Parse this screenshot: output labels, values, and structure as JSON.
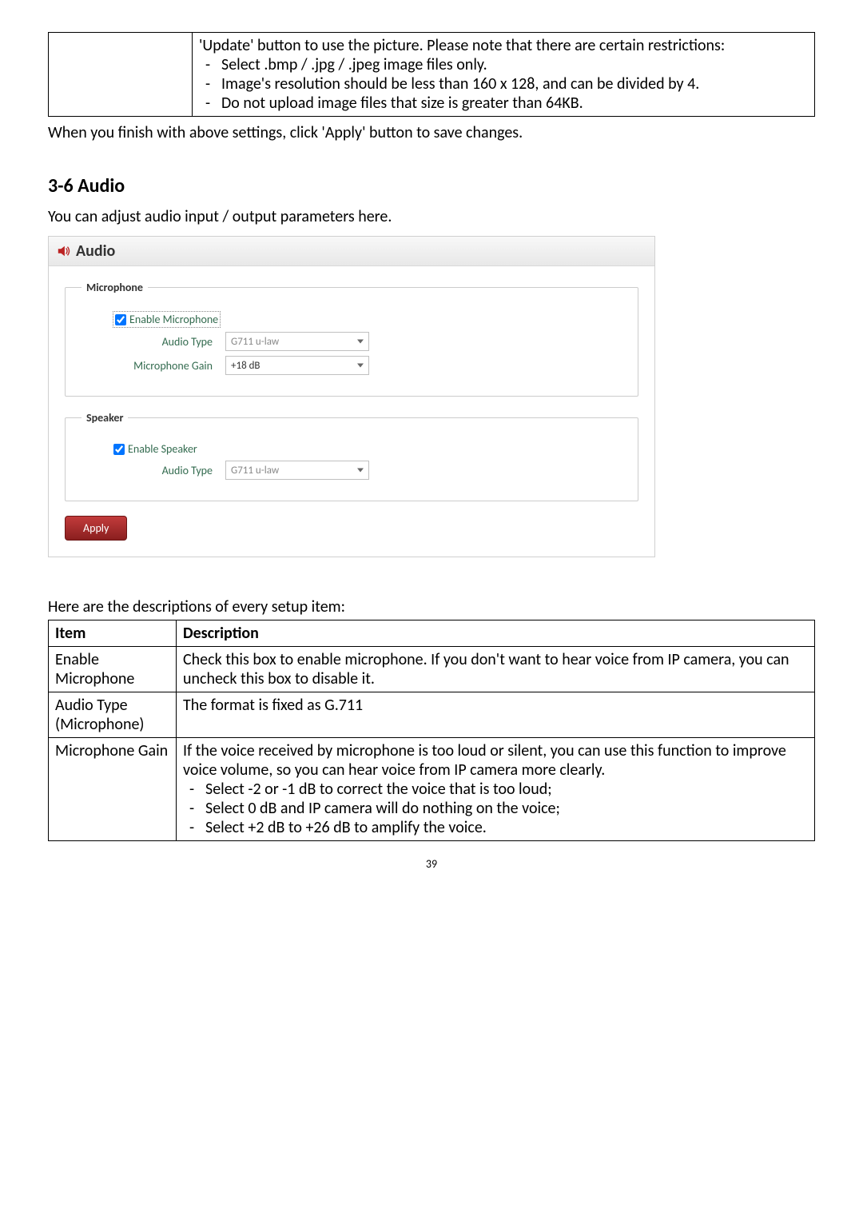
{
  "top_table": {
    "col1": "",
    "desc_line1": "'Update' button to use the picture. Please note that there are certain restrictions:",
    "bullets": [
      "Select .bmp / .jpg / .jpeg image files only.",
      "Image's resolution should be less than 160 x 128, and can be divided by 4.",
      "Do not upload image files that size is greater than 64KB."
    ]
  },
  "after_table_para": "When you finish with above settings, click 'Apply' button to save changes.",
  "section_heading": "3-6 Audio",
  "section_intro": "You can adjust audio input / output parameters here.",
  "panel": {
    "title": "Audio",
    "microphone": {
      "legend": "Microphone",
      "enable_label": "Enable Microphone",
      "enable_checked": true,
      "audio_type_label": "Audio Type",
      "audio_type_value": "G711 u-law",
      "gain_label": "Microphone Gain",
      "gain_value": "+18 dB"
    },
    "speaker": {
      "legend": "Speaker",
      "enable_label": "Enable Speaker",
      "enable_checked": true,
      "audio_type_label": "Audio Type",
      "audio_type_value": "G711 u-law"
    },
    "apply_label": "Apply"
  },
  "desc_intro": "Here are the descriptions of every setup item:",
  "desc_table": {
    "headers": [
      "Item",
      "Description"
    ],
    "rows": [
      {
        "item": "Enable Microphone",
        "desc": "Check this box to enable microphone. If you don't want to hear voice from IP camera, you can uncheck this box to disable it."
      },
      {
        "item": "Audio Type (Microphone)",
        "desc": "The format is fixed as G.711"
      },
      {
        "item": "Microphone Gain",
        "desc_line": "If the voice received by microphone is too loud or silent, you can use this function to improve voice volume, so you can hear voice from IP camera more clearly.",
        "bullets": [
          "Select -2 or -1 dB to correct the voice that is too loud;",
          "Select 0 dB and IP camera will do nothing on the voice;",
          "Select +2 dB to +26 dB to amplify the voice."
        ]
      }
    ]
  },
  "page_number": "39"
}
